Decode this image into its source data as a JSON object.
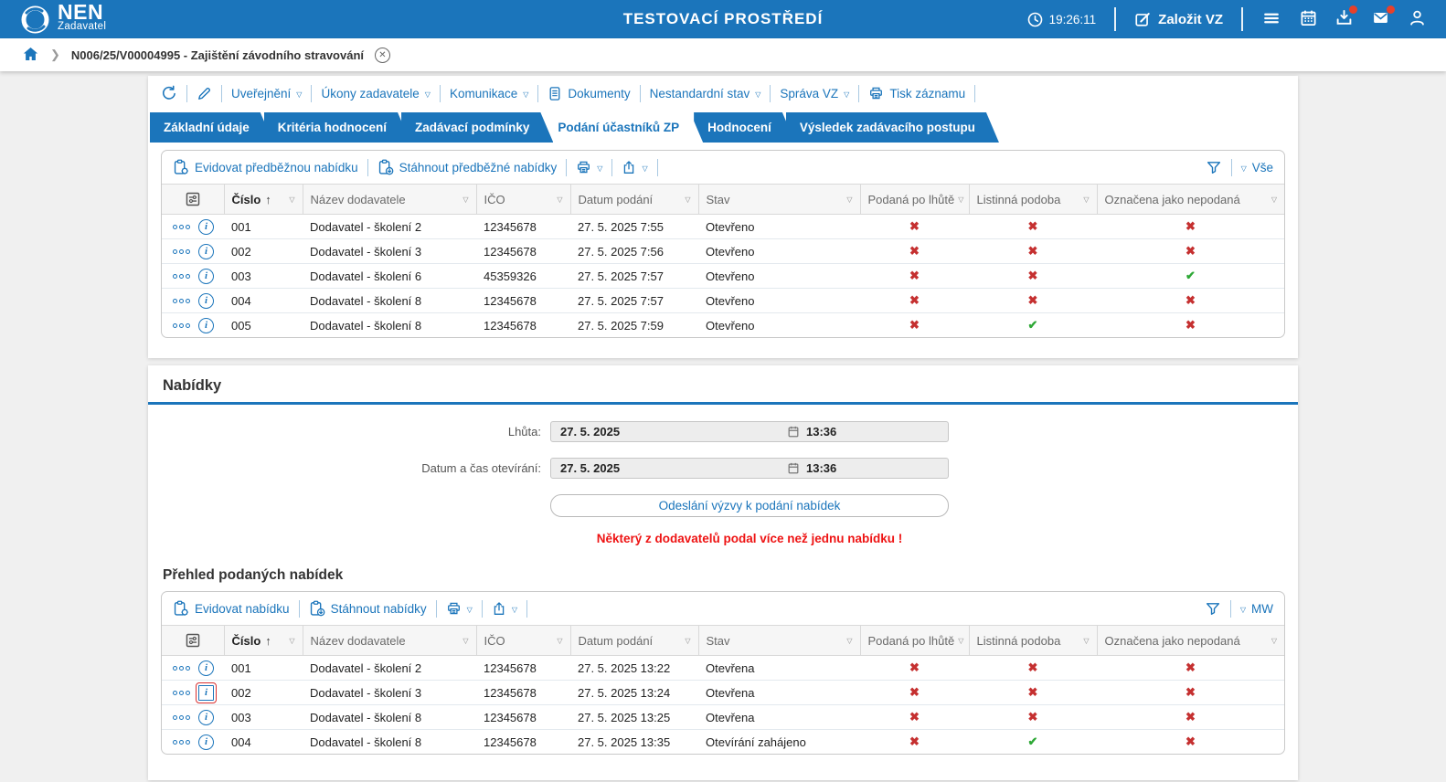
{
  "header": {
    "brand": "NEN",
    "brand_sub": "Zadavatel",
    "env_title": "TESTOVACÍ PROSTŘEDÍ",
    "time": "19:26:11",
    "create_vz_label": "Založit VZ",
    "icons": [
      {
        "name": "menu-icon",
        "badge": false
      },
      {
        "name": "calendar-icon",
        "badge": false
      },
      {
        "name": "downloads-icon",
        "badge": true
      },
      {
        "name": "messages-icon",
        "badge": true
      },
      {
        "name": "profile-icon",
        "badge": false
      }
    ]
  },
  "breadcrumb": {
    "item": "N006/25/V00004995 - Zajištění závodního stravování"
  },
  "page_toolbar": {
    "items": [
      {
        "name": "uverejneni",
        "label": "Uveřejnění",
        "caret": true
      },
      {
        "name": "ukony-zadavatele",
        "label": "Úkony zadavatele",
        "caret": true
      },
      {
        "name": "komunikace",
        "label": "Komunikace",
        "caret": true
      },
      {
        "name": "dokumenty",
        "label": "Dokumenty",
        "icon": "document"
      },
      {
        "name": "nestandardni-stav",
        "label": "Nestandardní stav",
        "caret": true
      },
      {
        "name": "sprava-vz",
        "label": "Správa VZ",
        "caret": true
      },
      {
        "name": "tisk-zaznamu",
        "label": "Tisk záznamu",
        "icon": "printer"
      }
    ]
  },
  "tabs": [
    {
      "name": "zakladni-udaje",
      "label": "Základní údaje",
      "active": false
    },
    {
      "name": "kriteria-hodnoceni",
      "label": "Kritéria hodnocení",
      "active": false
    },
    {
      "name": "zadavaci-podminky",
      "label": "Zadávací podmínky",
      "active": false
    },
    {
      "name": "podani-ucastniku-zp",
      "label": "Podání účastníků ZP",
      "active": true
    },
    {
      "name": "hodnoceni",
      "label": "Hodnocení",
      "active": false
    },
    {
      "name": "vysledek-zadavaciho-postupu",
      "label": "Výsledek zadávacího postupu",
      "active": false
    }
  ],
  "columns": [
    {
      "label": "Číslo",
      "sorted": "asc"
    },
    {
      "label": "Název dodavatele"
    },
    {
      "label": "IČO"
    },
    {
      "label": "Datum podání"
    },
    {
      "label": "Stav"
    },
    {
      "label": "Podaná po lhůtě"
    },
    {
      "label": "Listinná podoba"
    },
    {
      "label": "Označena jako nepodaná"
    }
  ],
  "preliminary_table": {
    "toolbar": [
      {
        "name": "evidovat-predbeznou-nabidku",
        "label": "Evidovat předběžnou nabídku",
        "icon": "clipboard-gear"
      },
      {
        "name": "stahnout-predbezne-nabidky",
        "label": "Stáhnout předběžné nabídky",
        "icon": "clipboard-download"
      },
      {
        "name": "print",
        "icon": "printer",
        "caret": true
      },
      {
        "name": "export",
        "icon": "export",
        "caret": true
      }
    ],
    "filter_label": "Vše",
    "rows": [
      {
        "num": "001",
        "supplier": "Dodavatel - školení 2",
        "ico": "12345678",
        "date": "27. 5. 2025 7:55",
        "status": "Otevřeno",
        "late": false,
        "paper": false,
        "not_submitted": false
      },
      {
        "num": "002",
        "supplier": "Dodavatel - školení 3",
        "ico": "12345678",
        "date": "27. 5. 2025 7:56",
        "status": "Otevřeno",
        "late": false,
        "paper": false,
        "not_submitted": false
      },
      {
        "num": "003",
        "supplier": "Dodavatel - školení 6",
        "ico": "45359326",
        "date": "27. 5. 2025 7:57",
        "status": "Otevřeno",
        "late": false,
        "paper": false,
        "not_submitted": true
      },
      {
        "num": "004",
        "supplier": "Dodavatel - školení 8",
        "ico": "12345678",
        "date": "27. 5. 2025 7:57",
        "status": "Otevřeno",
        "late": false,
        "paper": false,
        "not_submitted": false
      },
      {
        "num": "005",
        "supplier": "Dodavatel - školení 8",
        "ico": "12345678",
        "date": "27. 5. 2025 7:59",
        "status": "Otevřeno",
        "late": false,
        "paper": true,
        "not_submitted": false
      }
    ]
  },
  "offers_section": {
    "title": "Nabídky",
    "fields": [
      {
        "name": "lhuta",
        "label": "Lhůta:",
        "date": "27. 5. 2025",
        "time": "13:36"
      },
      {
        "name": "datum-cas-otevirani",
        "label": "Datum a čas otevírání:",
        "date": "27. 5. 2025",
        "time": "13:36"
      }
    ],
    "send_button": "Odeslání výzvy k podání nabídek",
    "warning": "Některý z dodavatelů podal více než jednu nabídku !"
  },
  "submitted_table": {
    "heading": "Přehled podaných nabídek",
    "toolbar": [
      {
        "name": "evidovat-nabidku",
        "label": "Evidovat nabídku",
        "icon": "clipboard-gear"
      },
      {
        "name": "stahnout-nabidky",
        "label": "Stáhnout nabídky",
        "icon": "clipboard-download"
      },
      {
        "name": "print",
        "icon": "printer",
        "caret": true
      },
      {
        "name": "export",
        "icon": "export",
        "caret": true
      }
    ],
    "filter_label": "MW",
    "rows": [
      {
        "num": "001",
        "supplier": "Dodavatel - školení 2",
        "ico": "12345678",
        "date": "27. 5. 2025 13:22",
        "status": "Otevřena",
        "late": false,
        "paper": false,
        "not_submitted": false
      },
      {
        "num": "002",
        "supplier": "Dodavatel - školení 3",
        "ico": "12345678",
        "date": "27. 5. 2025 13:24",
        "status": "Otevřena",
        "late": false,
        "paper": false,
        "not_submitted": false,
        "info_highlighted": true
      },
      {
        "num": "003",
        "supplier": "Dodavatel - školení 8",
        "ico": "12345678",
        "date": "27. 5. 2025 13:25",
        "status": "Otevřena",
        "late": false,
        "paper": false,
        "not_submitted": false
      },
      {
        "num": "004",
        "supplier": "Dodavatel - školení 8",
        "ico": "12345678",
        "date": "27. 5. 2025 13:35",
        "status": "Otevírání zahájeno",
        "late": false,
        "paper": true,
        "not_submitted": false
      }
    ]
  },
  "colors": {
    "primary_blue": "#1b75bb",
    "check_green": "#2ea836",
    "cross_red": "#c53030",
    "warning_red": "#ee1313",
    "badge_red": "#e8402a"
  }
}
